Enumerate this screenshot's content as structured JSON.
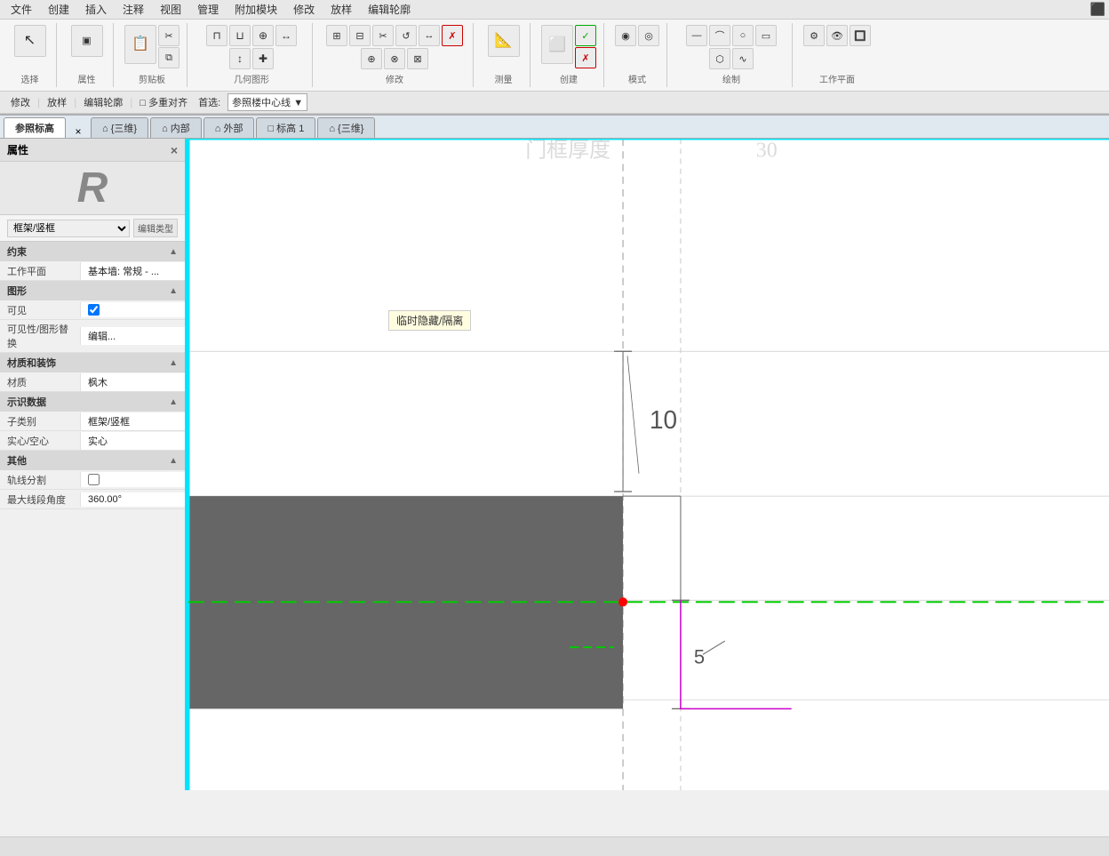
{
  "menubar": {
    "items": [
      "文件",
      "创建",
      "插入",
      "注释",
      "视图",
      "管理",
      "附加模块",
      "修改",
      "放样",
      "编辑轮廓"
    ]
  },
  "ribbon": {
    "tabs": [
      "修改",
      "放样",
      "编辑轮廓"
    ],
    "active_tab": "编辑轮廓",
    "groups": [
      {
        "label": "选择",
        "tools": [
          "▶"
        ]
      },
      {
        "label": "属性",
        "tools": [
          "□"
        ]
      },
      {
        "label": "剪贴板",
        "tools": [
          "✂",
          "📋",
          "📄"
        ]
      },
      {
        "label": "几何图形",
        "tools": [
          "⊓",
          "⌐",
          "⌒",
          "↔",
          "↕",
          "⊕",
          "⊗"
        ]
      },
      {
        "label": "修改",
        "tools": [
          "⊞",
          "✂",
          "⊕",
          "⊗",
          "↺",
          "↔",
          "↕"
        ]
      },
      {
        "label": "测量",
        "tools": [
          "📐"
        ]
      },
      {
        "label": "创建",
        "tools": [
          "◻",
          "✓",
          "✗"
        ]
      },
      {
        "label": "模式",
        "tools": [
          "◉",
          "◎"
        ]
      },
      {
        "label": "绘制",
        "tools": [
          "—",
          "⌒",
          "◯",
          "▭",
          "⬡"
        ]
      },
      {
        "label": "工作平面",
        "tools": [
          "⊞",
          "👁",
          "🔍"
        ]
      }
    ]
  },
  "toolbar2": {
    "items": [
      "修改",
      "|",
      "放样",
      "|",
      "编辑轮廓",
      "|",
      "□ 多重对齐",
      "首选:",
      "参照楼中心线",
      "▼"
    ]
  },
  "context_bar": {
    "breadcrumb": "修改 | 放样 > 编辑轮廓",
    "first_select": "首选:",
    "select_value": "参照楼中心线"
  },
  "view_tabs": [
    {
      "label": "参照标高",
      "active": true
    },
    {
      "label": "× ⌂ {三维}",
      "active": false
    },
    {
      "label": "⌂ 内部",
      "active": false
    },
    {
      "label": "⌂ 外部",
      "active": false
    },
    {
      "label": "□ 标高 1",
      "active": false
    },
    {
      "label": "⌂ {三维}",
      "active": false
    }
  ],
  "props_panel": {
    "title": "属性",
    "close_label": "×",
    "logo_letter": "R",
    "type_value": "框架/竖框",
    "edit_type_label": "编辑类型",
    "sections": [
      {
        "name": "约束",
        "rows": [
          {
            "label": "工作平面",
            "value": "基本墙: 常规 - ..."
          }
        ]
      },
      {
        "name": "图形",
        "rows": [
          {
            "label": "可见",
            "value": "checkbox",
            "checked": true
          },
          {
            "label": "可见性/图形替换",
            "value": "编辑..."
          }
        ]
      },
      {
        "name": "材质和装饰",
        "rows": [
          {
            "label": "材质",
            "value": "枫木"
          }
        ]
      },
      {
        "name": "示识数据",
        "rows": [
          {
            "label": "子类别",
            "value": "框架/竖框"
          },
          {
            "label": "实心/空心",
            "value": "实心"
          }
        ]
      },
      {
        "name": "其他",
        "rows": [
          {
            "label": "轨线分割",
            "value": "checkbox",
            "checked": false
          },
          {
            "label": "最大线段角度",
            "value": "360.00°"
          }
        ]
      }
    ]
  },
  "tooltip": {
    "text": "临时隐藏/隔离"
  },
  "canvas": {
    "dimension_10": "10",
    "dimension_5": "5"
  },
  "status_bar": {
    "text": ""
  }
}
